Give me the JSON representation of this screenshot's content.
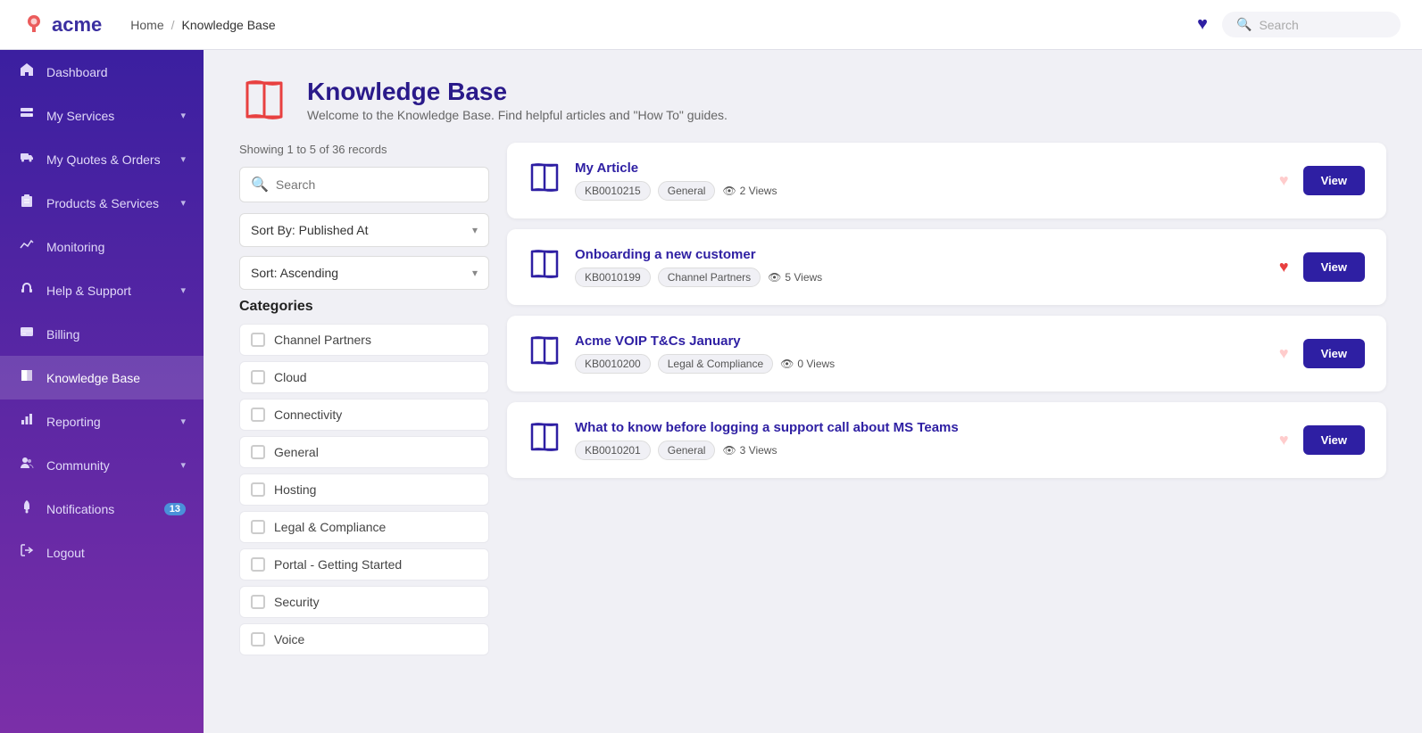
{
  "topnav": {
    "logo_text": "acme",
    "breadcrumb_home": "Home",
    "breadcrumb_current": "Knowledge Base",
    "search_placeholder": "Search",
    "heart_icon": "♥"
  },
  "sidebar": {
    "items": [
      {
        "id": "dashboard",
        "label": "Dashboard",
        "icon": "home",
        "active": false
      },
      {
        "id": "my-services",
        "label": "My Services",
        "icon": "server",
        "chevron": true,
        "active": false
      },
      {
        "id": "my-quotes",
        "label": "My Quotes & Orders",
        "icon": "truck",
        "chevron": true,
        "active": false
      },
      {
        "id": "products-services",
        "label": "Products & Services",
        "icon": "clipboard",
        "chevron": true,
        "active": false
      },
      {
        "id": "monitoring",
        "label": "Monitoring",
        "icon": "chart",
        "active": false
      },
      {
        "id": "help-support",
        "label": "Help & Support",
        "icon": "headset",
        "chevron": true,
        "active": false
      },
      {
        "id": "billing",
        "label": "Billing",
        "icon": "credit-card",
        "active": false
      },
      {
        "id": "knowledge-base",
        "label": "Knowledge Base",
        "icon": "book",
        "active": true
      },
      {
        "id": "reporting",
        "label": "Reporting",
        "icon": "bar-chart",
        "chevron": true,
        "active": false
      },
      {
        "id": "community",
        "label": "Community",
        "icon": "users",
        "chevron": true,
        "active": false
      },
      {
        "id": "notifications",
        "label": "Notifications",
        "icon": "bell",
        "badge": "13",
        "active": false
      },
      {
        "id": "logout",
        "label": "Logout",
        "icon": "logout",
        "active": false
      }
    ]
  },
  "page": {
    "title": "Knowledge Base",
    "subtitle": "Welcome to the Knowledge Base. Find helpful articles and \"How To\" guides."
  },
  "filters": {
    "records_count": "Showing 1 to 5 of 36 records",
    "search_placeholder": "Search",
    "sort_by_label": "Sort By: Published At",
    "sort_order_label": "Sort: Ascending"
  },
  "categories": {
    "title": "Categories",
    "items": [
      {
        "label": "Channel Partners",
        "checked": false
      },
      {
        "label": "Cloud",
        "checked": false
      },
      {
        "label": "Connectivity",
        "checked": false
      },
      {
        "label": "General",
        "checked": false
      },
      {
        "label": "Hosting",
        "checked": false
      },
      {
        "label": "Legal & Compliance",
        "checked": false
      },
      {
        "label": "Portal - Getting Started",
        "checked": false
      },
      {
        "label": "Security",
        "checked": false
      },
      {
        "label": "Voice",
        "checked": false
      }
    ]
  },
  "articles": [
    {
      "title": "My Article",
      "id": "KB0010215",
      "category": "General",
      "views": "2 Views",
      "liked": false,
      "view_btn": "View"
    },
    {
      "title": "Onboarding a new customer",
      "id": "KB0010199",
      "category": "Channel Partners",
      "views": "5 Views",
      "liked": true,
      "view_btn": "View"
    },
    {
      "title": "Acme VOIP T&Cs January",
      "id": "KB0010200",
      "category": "Legal & Compliance",
      "views": "0 Views",
      "liked": false,
      "view_btn": "View"
    },
    {
      "title": "What to know before logging a support call about MS Teams",
      "id": "KB0010201",
      "category": "General",
      "views": "3 Views",
      "liked": false,
      "view_btn": "View"
    }
  ]
}
